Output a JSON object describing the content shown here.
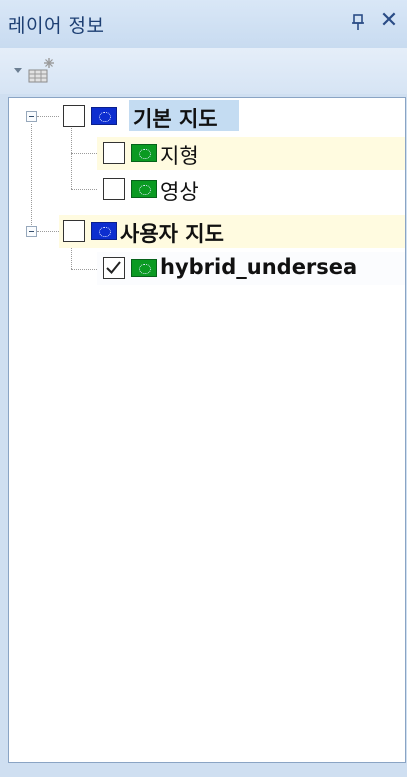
{
  "panel": {
    "title": "레이어 정보",
    "pin_icon": "pin-icon",
    "close_icon": "close-icon",
    "close_glyph": "✕"
  },
  "toolbar": {
    "dropdown_icon": "dropdown-arrow-icon",
    "tool_icon": "layer-sparkle-icon"
  },
  "tree": {
    "groups": [
      {
        "label": "기본 지도",
        "checked": false,
        "selected": true,
        "expanded": true,
        "icon": "blue-globe-icon",
        "children": [
          {
            "label": "지형",
            "checked": false,
            "icon": "green-globe-icon"
          },
          {
            "label": "영상",
            "checked": false,
            "icon": "green-globe-icon"
          }
        ]
      },
      {
        "label": "사용자 지도",
        "checked": false,
        "selected": false,
        "expanded": true,
        "icon": "blue-globe-icon",
        "children": [
          {
            "label": "hybrid_undersea",
            "checked": true,
            "icon": "green-globe-icon"
          }
        ]
      }
    ]
  },
  "colors": {
    "panel_bg": "#cfdff1",
    "title_text": "#1d3f73",
    "selection": "#c4dcf2",
    "row_highlight": "#fffbe0",
    "group_icon": "#0d2ecf",
    "layer_icon": "#0a9a22"
  }
}
